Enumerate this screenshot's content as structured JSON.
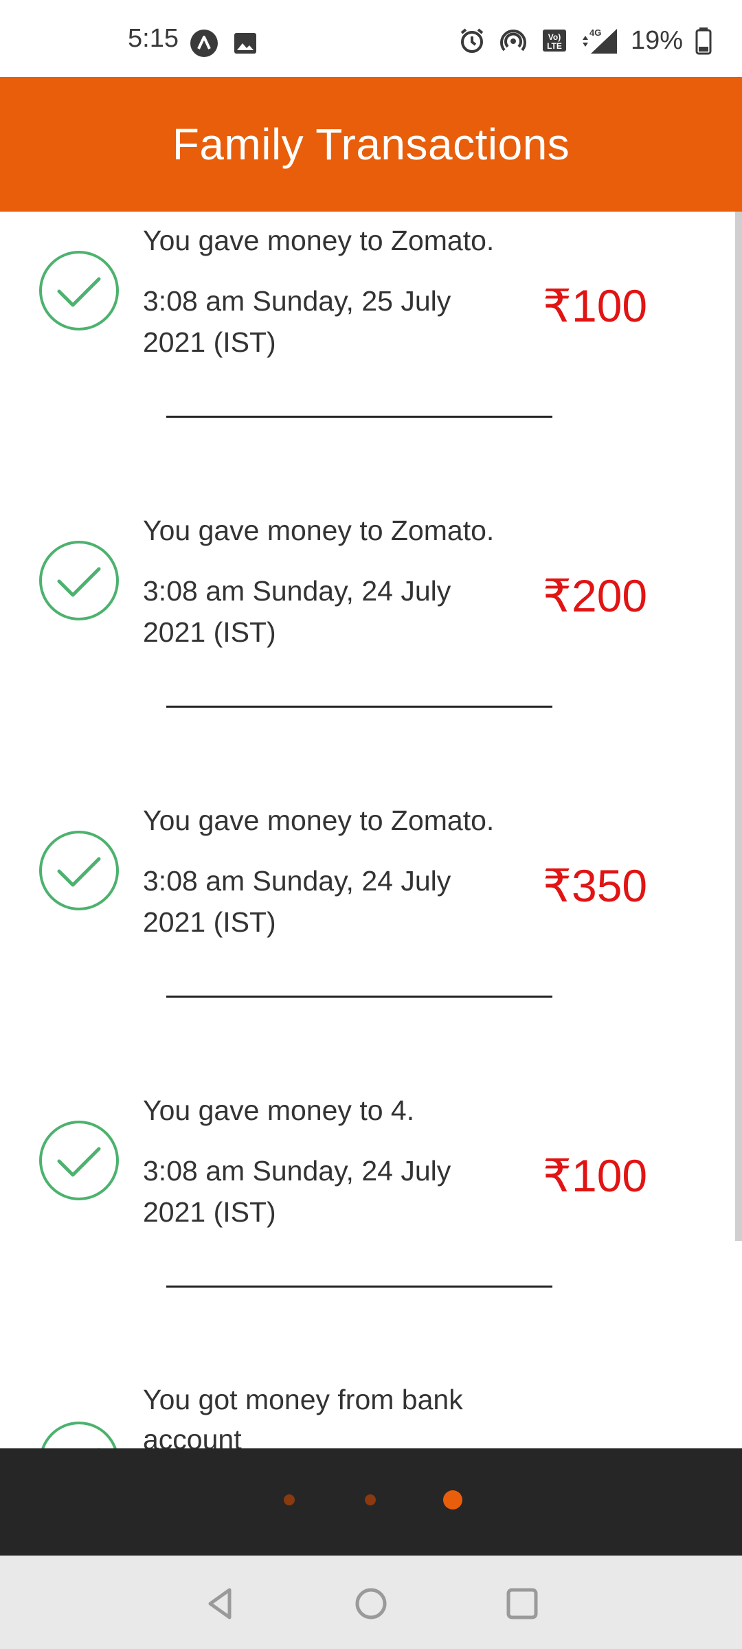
{
  "status_bar": {
    "time": "5:15",
    "battery_percent": "19%",
    "network_label": "4G",
    "left_icons": [
      "assistant-icon",
      "image-icon"
    ],
    "right_icons": [
      "alarm-icon",
      "hotspot-icon",
      "volte-icon",
      "signal-icon",
      "battery-icon"
    ]
  },
  "header": {
    "title": "Family Transactions",
    "color": "#E85E0A"
  },
  "transactions": [
    {
      "description": "You gave money to Zomato.",
      "date": "3:08 am Sunday, 25 July 2021 (IST)",
      "amount": "₹100",
      "status": "success"
    },
    {
      "description": "You gave money to Zomato.",
      "date": "3:08 am Sunday, 24 July 2021 (IST)",
      "amount": "₹200",
      "status": "success"
    },
    {
      "description": "You gave money to Zomato.",
      "date": "3:08 am Sunday, 24 July 2021 (IST)",
      "amount": "₹350",
      "status": "success"
    },
    {
      "description": "You gave money to 4.",
      "date": "3:08 am Sunday, 24 July 2021 (IST)",
      "amount": "₹100",
      "status": "success"
    },
    {
      "description": "You got money from bank account",
      "status": "success"
    }
  ],
  "pager": {
    "pages": 3,
    "active_index": 2,
    "active_color": "#E85E0A",
    "inactive_color": "#8A3A0E"
  },
  "colors": {
    "amount": "#E11414",
    "check": "#4CB26E"
  },
  "nav_bar": {
    "buttons": [
      "back-icon",
      "home-icon",
      "recents-icon"
    ]
  }
}
